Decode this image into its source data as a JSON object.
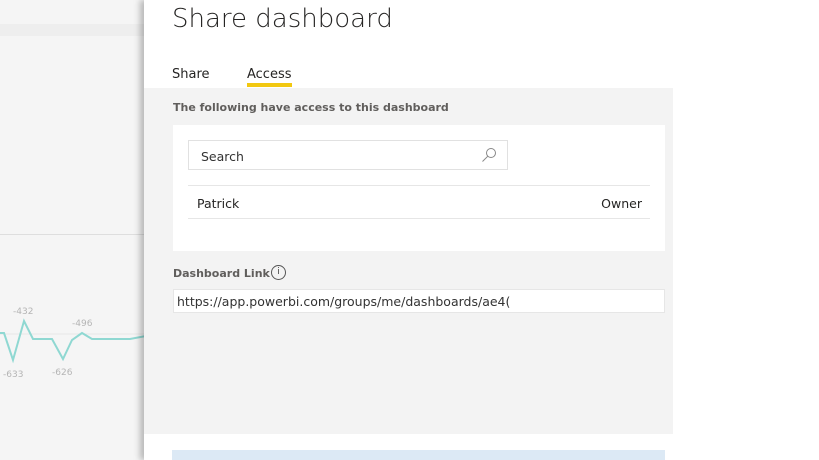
{
  "dialog": {
    "title": "Share dashboard",
    "tabs": [
      {
        "label": "Share"
      },
      {
        "label": "Access",
        "active": true
      }
    ],
    "access_heading": "The following have access to this dashboard",
    "search": {
      "placeholder": "Search"
    },
    "users": [
      {
        "name": "Patrick",
        "role": "Owner"
      }
    ],
    "link_label": "Dashboard Link",
    "link_value": "https://app.powerbi.com/groups/me/dashboards/ae4("
  },
  "background_chart": {
    "labels": [
      "-432",
      "-633",
      "-626",
      "-496"
    ]
  },
  "colors": {
    "accent": "#f2c811",
    "line": "#8fd8d2"
  }
}
